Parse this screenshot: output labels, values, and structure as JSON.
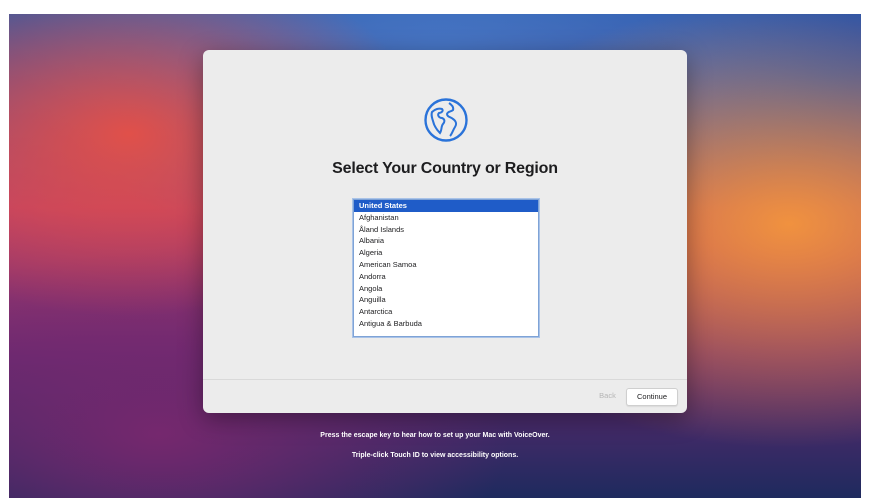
{
  "setup": {
    "title": "Select Your Country or Region",
    "icon": "globe-icon",
    "countries": [
      "United States",
      "Afghanistan",
      "Åland Islands",
      "Albania",
      "Algeria",
      "American Samoa",
      "Andorra",
      "Angola",
      "Anguilla",
      "Antarctica",
      "Antigua & Barbuda"
    ],
    "selected_country": "United States",
    "back_label": "Back",
    "continue_label": "Continue"
  },
  "hints": {
    "voiceover": "Press the escape key to hear how to set up your Mac with VoiceOver.",
    "touch_id": "Triple-click Touch ID to view accessibility options."
  },
  "colors": {
    "selection": "#1f5cc8",
    "globe": "#2a73d9"
  }
}
